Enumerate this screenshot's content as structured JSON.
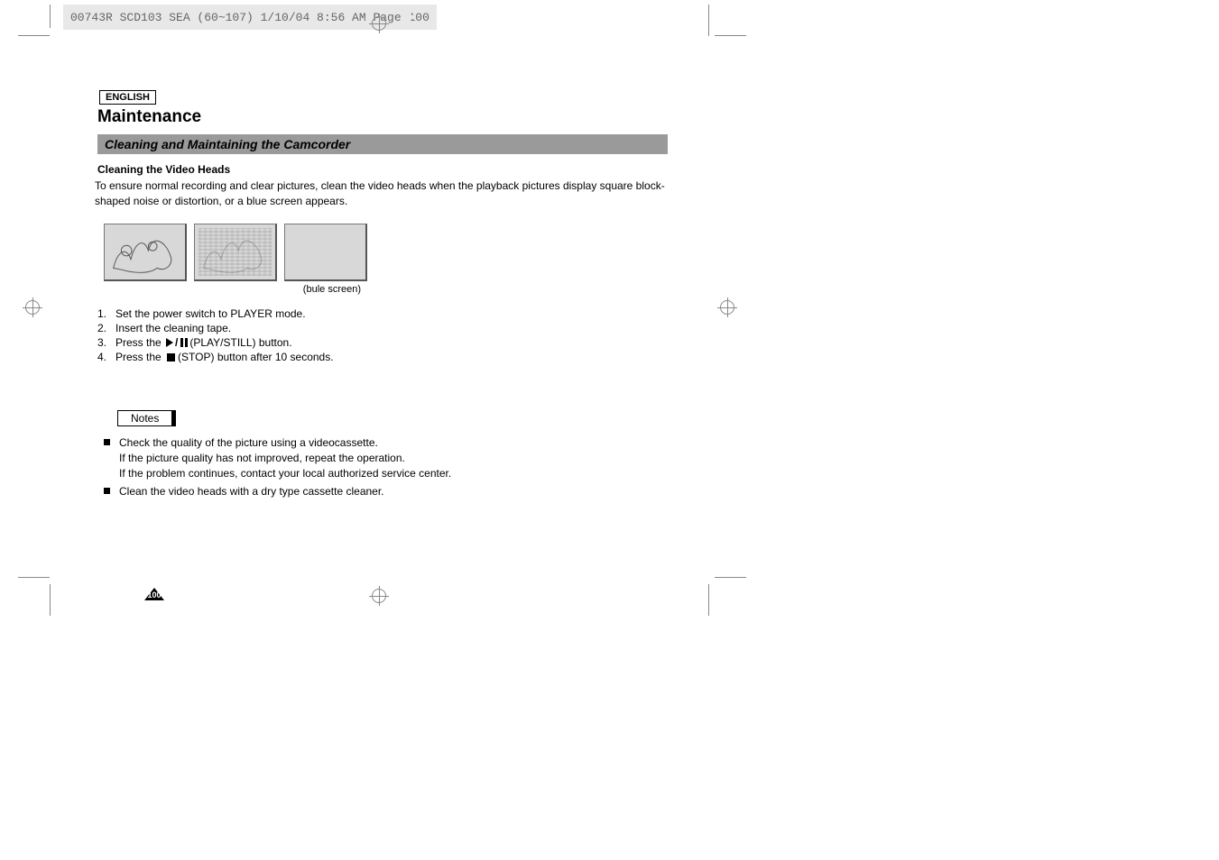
{
  "header_tag": "00743R SCD103 SEA (60~107)  1/10/04 8:56 AM  Page 100",
  "language_label": "ENGLISH",
  "title": "Maintenance",
  "subtitle": "Cleaning and Maintaining the Camcorder",
  "sub_heading": "Cleaning the Video Heads",
  "intro_text": "To ensure normal recording and clear pictures, clean the video heads when the playback pictures display square block-shaped noise or distortion, or a blue screen appears.",
  "caption": "(bule screen)",
  "steps": [
    {
      "num": "1.",
      "text": "Set the power switch to PLAYER mode."
    },
    {
      "num": "2.",
      "text": "Insert the cleaning tape."
    },
    {
      "num": "3.",
      "prefix": "Press the ",
      "suffix": "(PLAY/STILL) button.",
      "icon": "play-pause"
    },
    {
      "num": "4.",
      "prefix": "Press the ",
      "suffix": "(STOP) button after 10 seconds.",
      "icon": "stop"
    }
  ],
  "notes_label": "Notes",
  "notes": [
    {
      "lines": [
        "Check the quality of the picture using a videocassette.",
        "If the picture quality has not improved, repeat the operation.",
        "If the problem continues, contact your local authorized service center."
      ]
    },
    {
      "lines": [
        "Clean the video heads with a dry type cassette cleaner."
      ]
    }
  ],
  "page_number": "100"
}
